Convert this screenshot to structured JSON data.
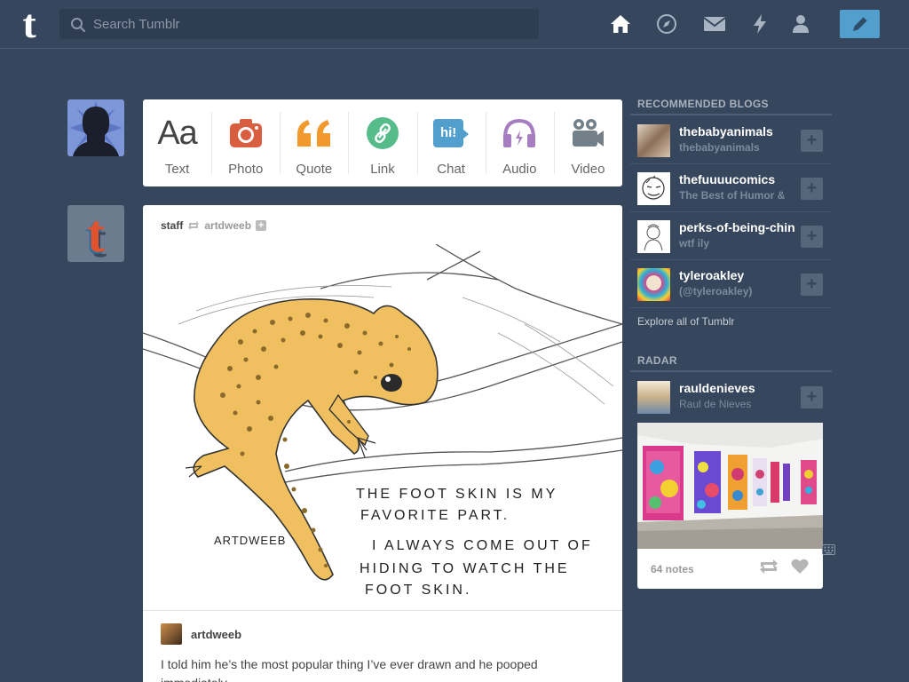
{
  "header": {
    "logo": "t",
    "search_placeholder": "Search Tumblr",
    "nav": [
      {
        "name": "home-icon",
        "active": true
      },
      {
        "name": "explore-compass-icon",
        "active": false
      },
      {
        "name": "messages-envelope-icon",
        "active": false
      },
      {
        "name": "activity-bolt-icon",
        "active": false
      },
      {
        "name": "account-person-icon",
        "active": false
      }
    ],
    "compose_icon": "pencil-icon"
  },
  "post_types": [
    {
      "label": "Text",
      "icon": "text-aa-icon",
      "glyph": "Aa",
      "color": "#444444"
    },
    {
      "label": "Photo",
      "icon": "camera-icon",
      "color": "#d95e40"
    },
    {
      "label": "Quote",
      "icon": "quote-icon",
      "glyph": "“",
      "color": "#f2992e"
    },
    {
      "label": "Link",
      "icon": "link-icon",
      "color": "#56bc8a"
    },
    {
      "label": "Chat",
      "icon": "chat-bubble-icon",
      "glyph": "hi!",
      "color": "#529ecc"
    },
    {
      "label": "Audio",
      "icon": "headphones-icon",
      "color": "#a77dc2"
    },
    {
      "label": "Video",
      "icon": "video-camera-icon",
      "color": "#748089"
    }
  ],
  "post": {
    "author": "staff",
    "reblog_source": "artdweeb",
    "art_text": {
      "signature": "ARTDWEEB",
      "lines": [
        "THE FOOT SKIN IS MY",
        "FAVORITE PART.",
        "I ALWAYS COME OUT OF",
        "HIDING TO WATCH THE",
        "FOOT SKIN."
      ]
    },
    "reblogger": "artdweeb",
    "caption": "I told him he’s the most popular thing I’ve ever drawn and he pooped immediately."
  },
  "sidebar": {
    "recommended_title": "RECOMMENDED BLOGS",
    "blogs": [
      {
        "name": "thebabyanimals",
        "subtitle": "thebabyanimals"
      },
      {
        "name": "thefuuuucomics",
        "subtitle": "The Best of Humor &"
      },
      {
        "name": "perks-of-being-chin",
        "subtitle": "wtf ily"
      },
      {
        "name": "tyleroakley",
        "subtitle": "(@tyleroakley)"
      }
    ],
    "follow_label": "+",
    "explore_label": "Explore all of Tumblr",
    "radar_title": "RADAR",
    "radar": {
      "name": "rauldenieves",
      "subtitle": "Raul de Nieves",
      "notes": "64 notes"
    }
  },
  "colors": {
    "background": "#36465d",
    "accent": "#529ecc",
    "search_bg": "#2e3d52"
  }
}
